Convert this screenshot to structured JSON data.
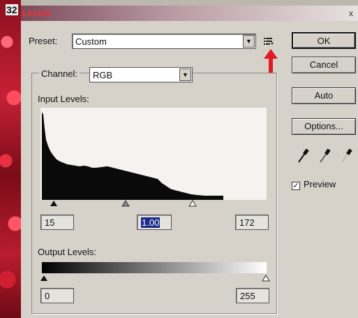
{
  "window": {
    "page_number": "32",
    "title": "Levels",
    "close_glyph": "x"
  },
  "preset": {
    "label": "Preset:",
    "value": "Custom",
    "menu_icon": "list-menu-icon"
  },
  "buttons": {
    "ok": "OK",
    "cancel": "Cancel",
    "auto": "Auto",
    "options": "Options..."
  },
  "channel": {
    "label": "Channel:",
    "value": "RGB"
  },
  "input_levels": {
    "label": "Input Levels:",
    "black": "15",
    "gamma": "1.00",
    "white": "172"
  },
  "output_levels": {
    "label": "Output Levels:",
    "black": "0",
    "white": "255"
  },
  "preview": {
    "label": "Preview",
    "checked": true
  },
  "colors": {
    "annotation_arrow": "#e01b24",
    "title_text": "#e8332f",
    "selection": "#1b2a8a"
  }
}
